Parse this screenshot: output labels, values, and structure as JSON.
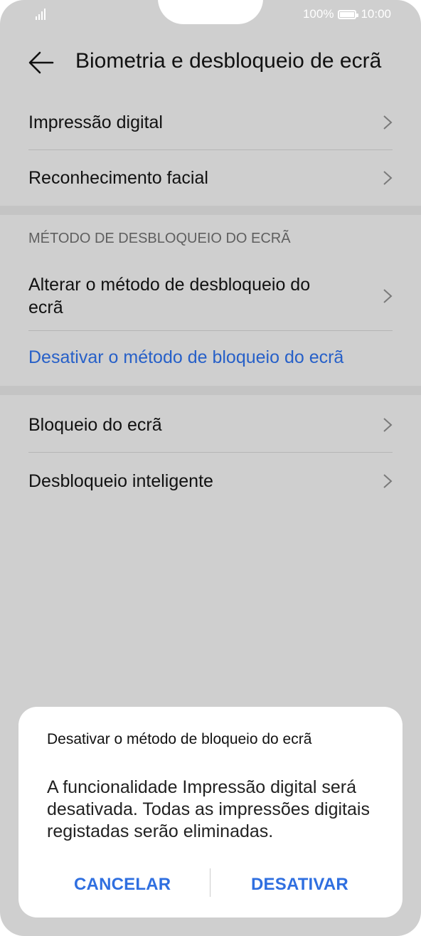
{
  "status_bar": {
    "battery_percent": "100%",
    "time": "10:00"
  },
  "header": {
    "title": "Biometria e desbloqueio de ecrã"
  },
  "items": {
    "fingerprint": "Impressão digital",
    "face": "Reconhecimento facial",
    "section_title": "MÉTODO DE DESBLOQUEIO DO ECRÃ",
    "change_method_line1": "Alterar o método de desbloqueio do",
    "change_method_line2": "ecrã",
    "disable_method": "Desativar o método de bloqueio do ecrã",
    "screen_lock": "Bloqueio do ecrã",
    "smart_unlock": "Desbloqueio inteligente"
  },
  "dialog": {
    "title": "Desativar o método de bloqueio do ecrã",
    "body": "A funcionalidade Impressão digital será desativada. Todas as impressões digitais registadas serão eliminadas.",
    "cancel": "CANCELAR",
    "confirm": "DESATIVAR"
  },
  "colors": {
    "accent": "#2f6fe0",
    "link": "#2760c8",
    "scrim": "#cfcfcf"
  }
}
